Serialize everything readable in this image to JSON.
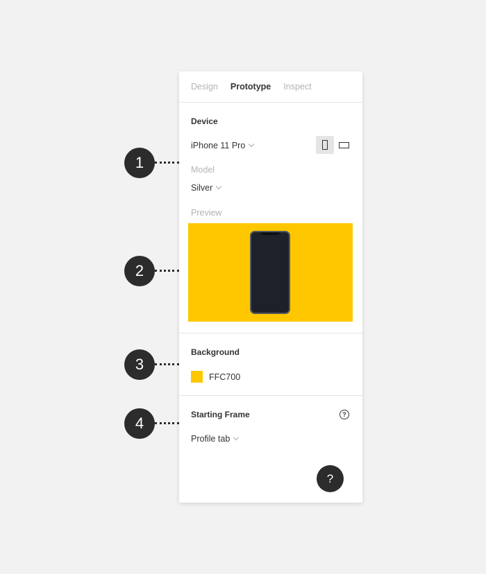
{
  "tabs": [
    {
      "label": "Design",
      "active": false
    },
    {
      "label": "Prototype",
      "active": true
    },
    {
      "label": "Inspect",
      "active": false
    }
  ],
  "device": {
    "title": "Device",
    "selected_device": "iPhone 11 Pro",
    "orientation": "portrait",
    "model_label": "Model",
    "model_value": "Silver",
    "preview_label": "Preview",
    "preview_bg": "#FFC700"
  },
  "background": {
    "title": "Background",
    "color_hex": "FFC700",
    "swatch_color": "#FFC700"
  },
  "starting_frame": {
    "title": "Starting Frame",
    "value": "Profile tab"
  },
  "help_fab": {
    "label": "?"
  },
  "callouts": [
    "1",
    "2",
    "3",
    "4"
  ]
}
